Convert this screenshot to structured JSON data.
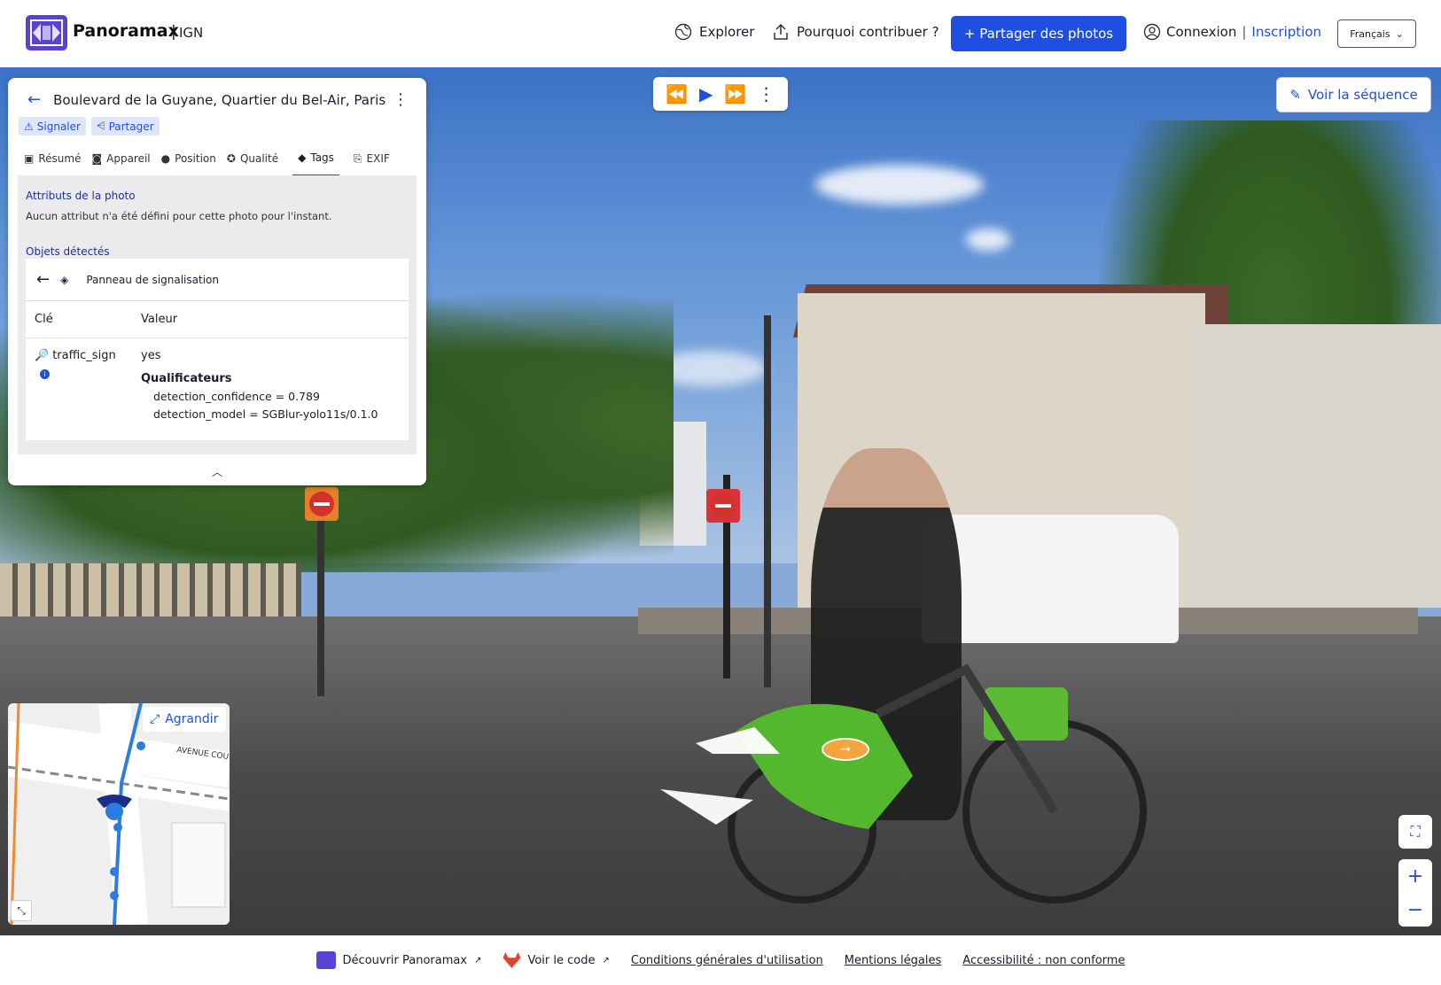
{
  "header": {
    "brand": "Panoramax",
    "brand_separator": "|",
    "brand_org": "IGN",
    "nav_explore": "Explorer",
    "nav_why": "Pourquoi contribuer ?",
    "share_button": "+ Partager des photos",
    "login": "Connexion",
    "login_separator": "|",
    "signup": "Inscription",
    "language": "Français"
  },
  "player": {
    "prev_icon": "rewind-icon",
    "play_icon": "play-icon",
    "next_icon": "fast-forward-icon",
    "more_icon": "more-vertical-icon"
  },
  "sequence_button": "Voir la séquence",
  "panel": {
    "title": "Boulevard de la Guyane, Quartier du Bel-Air, Paris",
    "chips": [
      "Signaler",
      "Partager"
    ],
    "tabs": [
      {
        "label": "Résumé",
        "icon": "image-icon"
      },
      {
        "label": "Appareil",
        "icon": "camera-icon"
      },
      {
        "label": "Position",
        "icon": "map-pin-icon"
      },
      {
        "label": "Qualité",
        "icon": "medal-icon"
      },
      {
        "label": "Tags",
        "icon": "tags-icon",
        "active": true
      },
      {
        "label": "EXIF",
        "icon": "exif-icon"
      }
    ],
    "attributes_title": "Attributs de la photo",
    "attributes_text": "Aucun attribut n'a été défini pour cette photo pour l'instant.",
    "objects_title": "Objets détectés",
    "object_name": "Panneau de signalisation",
    "table_key_header": "Clé",
    "table_value_header": "Valeur",
    "row_key": "traffic_sign",
    "row_value": "yes",
    "qualifiers_title": "Qualificateurs",
    "qualifier_confidence": "detection_confidence = 0.789",
    "qualifier_model": "detection_model = SGBlur-yolo11s/0.1.0"
  },
  "minimap": {
    "expand_label": "Agrandir",
    "street_label": "AVENUE COU"
  },
  "footer": {
    "discover": "Découvrir Panoramax",
    "code": "Voir le code",
    "terms": "Conditions générales d'utilisation",
    "legal": "Mentions légales",
    "accessibility": "Accessibilité : non conforme"
  },
  "colors": {
    "accent": "#1f4fe0",
    "brand": "#5a42d6",
    "chip_bg": "#dfe6fb"
  }
}
